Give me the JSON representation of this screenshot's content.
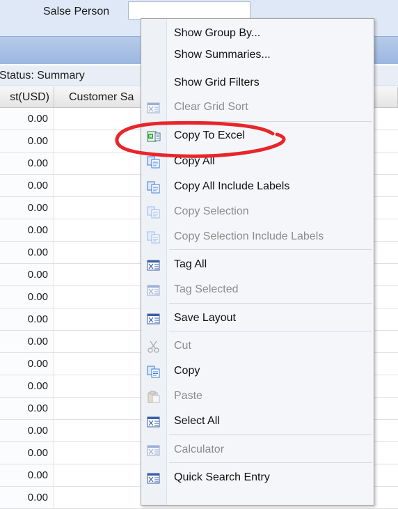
{
  "filter": {
    "salesperson_label": "Salse Person",
    "salesperson_value": ""
  },
  "status": {
    "text": "Status: Summary"
  },
  "grid": {
    "columns": [
      "st(USD)",
      "Customer Sa"
    ],
    "rows": [
      "0.00",
      "0.00",
      "0.00",
      "0.00",
      "0.00",
      "0.00",
      "0.00",
      "0.00",
      "0.00",
      "0.00",
      "0.00",
      "0.00",
      "0.00",
      "0.00",
      "0.00",
      "0.00",
      "0.00",
      "0.00"
    ]
  },
  "context_menu": {
    "items": [
      {
        "label": "Show Group By...",
        "icon": "none",
        "enabled": true
      },
      {
        "label": "Show Summaries...",
        "icon": "none",
        "enabled": true
      },
      {
        "label": "Show Grid Filters",
        "icon": "none",
        "enabled": true
      },
      {
        "label": "Clear Grid Sort",
        "icon": "grid-icon",
        "enabled": false
      },
      {
        "label": "Copy To Excel",
        "icon": "excel-icon",
        "enabled": true
      },
      {
        "label": "Copy All",
        "icon": "copy-icon",
        "enabled": true
      },
      {
        "label": "Copy All Include Labels",
        "icon": "copy-icon",
        "enabled": true
      },
      {
        "label": "Copy Selection",
        "icon": "copy-icon",
        "enabled": false
      },
      {
        "label": "Copy Selection Include Labels",
        "icon": "copy-icon",
        "enabled": false
      },
      {
        "label": "Tag All",
        "icon": "grid-icon",
        "enabled": true
      },
      {
        "label": "Tag Selected",
        "icon": "grid-icon",
        "enabled": false
      },
      {
        "label": "Save Layout",
        "icon": "grid-icon",
        "enabled": true
      },
      {
        "label": "Cut",
        "icon": "scissors-icon",
        "enabled": false
      },
      {
        "label": "Copy",
        "icon": "copy-icon",
        "enabled": true
      },
      {
        "label": "Paste",
        "icon": "clipboard-icon",
        "enabled": false
      },
      {
        "label": "Select All",
        "icon": "grid-icon",
        "enabled": true
      },
      {
        "label": "Calculator",
        "icon": "grid-icon",
        "enabled": false
      },
      {
        "label": "Quick Search Entry",
        "icon": "grid-icon",
        "enabled": true
      }
    ]
  },
  "colors": {
    "header_blue": "#9cb7e0",
    "menu_bg": "#f4f6fa",
    "annotation_red": "#e8262a"
  }
}
